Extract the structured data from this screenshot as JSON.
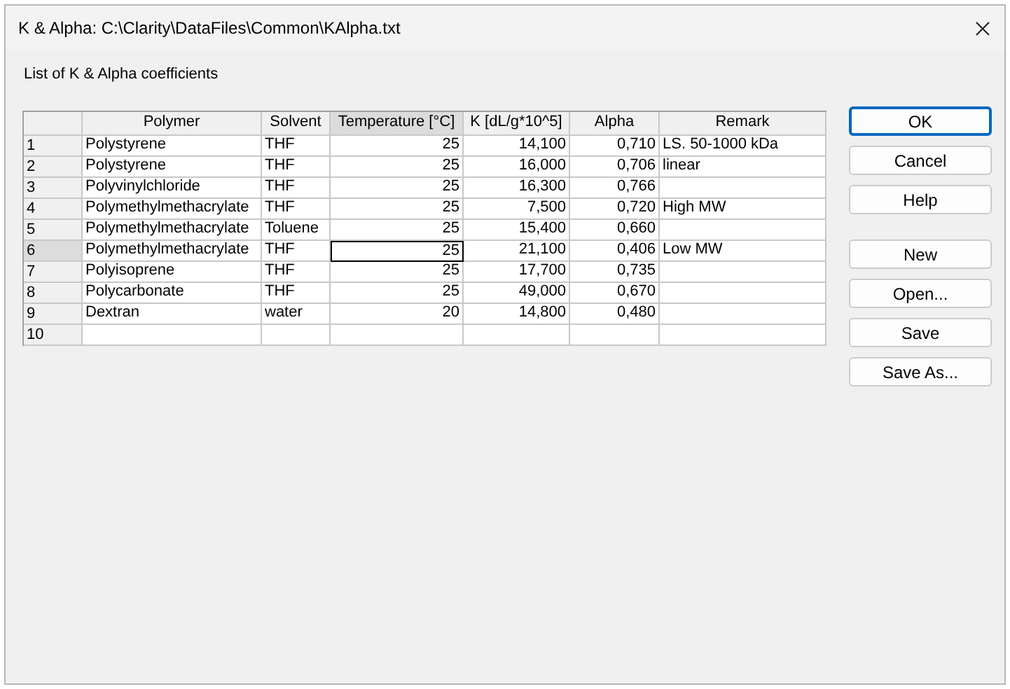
{
  "window": {
    "title": "K & Alpha: C:\\Clarity\\DataFiles\\Common\\KAlpha.txt"
  },
  "caption": "List of K & Alpha coefficients",
  "table": {
    "columns": [
      {
        "label": "Polymer",
        "kind": "text",
        "selected": false
      },
      {
        "label": "Solvent",
        "kind": "text",
        "selected": false
      },
      {
        "label": "Temperature [°C]",
        "kind": "number",
        "selected": true
      },
      {
        "label": "K [dL/g*10^5]",
        "kind": "number",
        "selected": false
      },
      {
        "label": "Alpha",
        "kind": "number",
        "selected": false
      },
      {
        "label": "Remark",
        "kind": "text",
        "selected": false
      }
    ],
    "rows": [
      {
        "number": "1",
        "selected": false,
        "cells": [
          "Polystyrene",
          "THF",
          "25",
          "14,100",
          "0,710",
          "LS. 50-1000 kDa"
        ]
      },
      {
        "number": "2",
        "selected": false,
        "cells": [
          "Polystyrene",
          "THF",
          "25",
          "16,000",
          "0,706",
          "linear"
        ]
      },
      {
        "number": "3",
        "selected": false,
        "cells": [
          "Polyvinylchloride",
          "THF",
          "25",
          "16,300",
          "0,766",
          ""
        ]
      },
      {
        "number": "4",
        "selected": false,
        "cells": [
          "Polymethylmethacrylate",
          "THF",
          "25",
          "7,500",
          "0,720",
          "High MW"
        ]
      },
      {
        "number": "5",
        "selected": false,
        "cells": [
          "Polymethylmethacrylate",
          "Toluene",
          "25",
          "15,400",
          "0,660",
          ""
        ]
      },
      {
        "number": "6",
        "selected": true,
        "cells": [
          "Polymethylmethacrylate",
          "THF",
          "25",
          "21,100",
          "0,406",
          "Low MW"
        ]
      },
      {
        "number": "7",
        "selected": false,
        "cells": [
          "Polyisoprene",
          "THF",
          "25",
          "17,700",
          "0,735",
          ""
        ]
      },
      {
        "number": "8",
        "selected": false,
        "cells": [
          "Polycarbonate",
          "THF",
          "25",
          "49,000",
          "0,670",
          ""
        ]
      },
      {
        "number": "9",
        "selected": false,
        "cells": [
          "Dextran",
          "water",
          "20",
          "14,800",
          "0,480",
          ""
        ]
      },
      {
        "number": "10",
        "selected": false,
        "cells": [
          "",
          "",
          "",
          "",
          "",
          ""
        ]
      }
    ]
  },
  "button_groups": [
    [
      {
        "label": "OK",
        "default": true
      },
      {
        "label": "Cancel",
        "default": false
      },
      {
        "label": "Help",
        "default": false
      }
    ],
    [
      {
        "label": "New",
        "default": false
      },
      {
        "label": "Open...",
        "default": false
      },
      {
        "label": "Save",
        "default": false
      },
      {
        "label": "Save As...",
        "default": false
      }
    ]
  ]
}
